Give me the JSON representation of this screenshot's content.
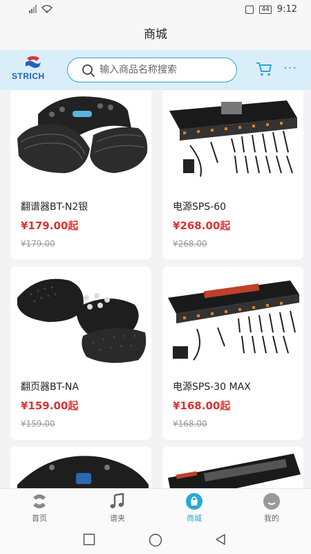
{
  "status_bar": {
    "time": "9:12",
    "battery": "44"
  },
  "title": "商城",
  "header": {
    "logo_text": "STRICH",
    "search_placeholder": "输入商品名称搜索"
  },
  "products": [
    {
      "name": "翻谱器BT-N2银",
      "price": "¥179.00起",
      "original_price": "¥179.00"
    },
    {
      "name": "电源SPS-60",
      "price": "¥268.00起",
      "original_price": "¥268.00"
    },
    {
      "name": "翻页器BT-NA",
      "price": "¥159.00起",
      "original_price": "¥159.00"
    },
    {
      "name": "电源SPS-30 MAX",
      "price": "¥168.00起",
      "original_price": "¥168.00"
    }
  ],
  "bottom_nav": [
    {
      "label": "首页",
      "icon": "home-logo-icon"
    },
    {
      "label": "谱夹",
      "icon": "music-note-icon"
    },
    {
      "label": "商城",
      "icon": "shop-bag-icon",
      "active": true
    },
    {
      "label": "我的",
      "icon": "profile-face-icon"
    }
  ],
  "colors": {
    "accent": "#2aa8d8",
    "price": "#e03030",
    "header_bg": "#d9eef9"
  }
}
